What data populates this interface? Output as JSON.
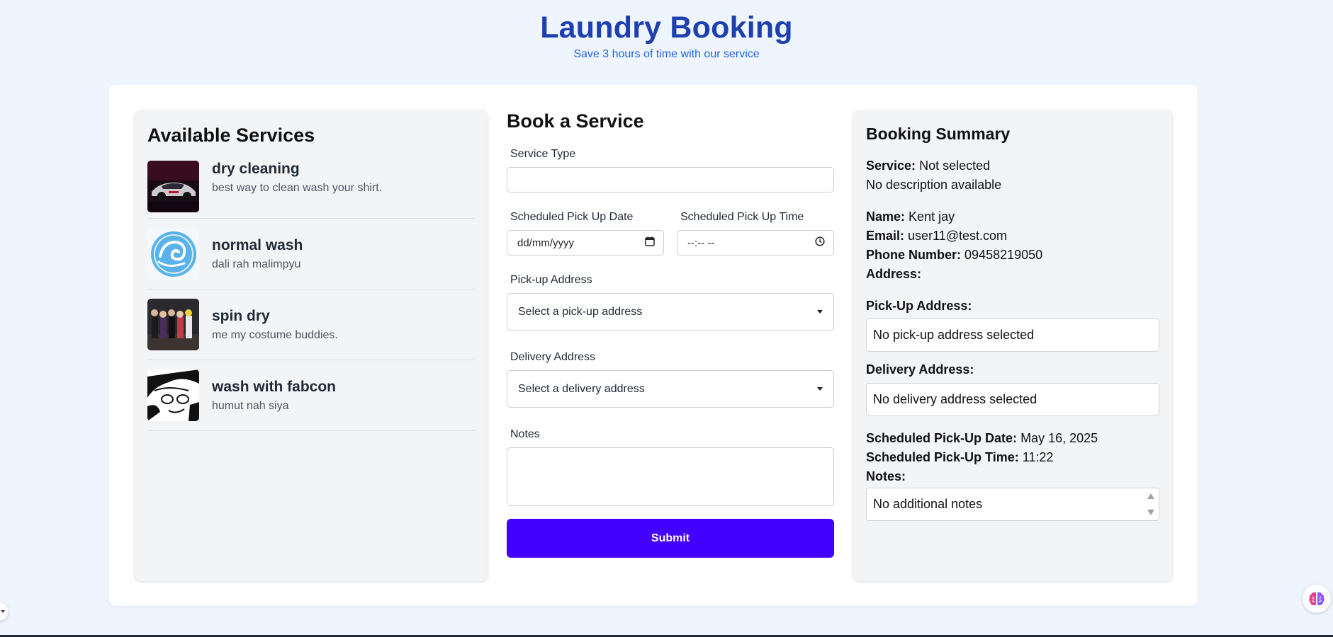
{
  "header": {
    "title": "Laundry Booking",
    "subtitle": "Save 3 hours of time with our service"
  },
  "services_panel": {
    "title": "Available Services",
    "items": [
      {
        "name": "dry cleaning",
        "description": "best way to clean wash your shirt.",
        "icon": "sports-car-photo"
      },
      {
        "name": "normal wash",
        "description": "dali rah malimpyu",
        "icon": "blue-swirl-logo"
      },
      {
        "name": "spin dry",
        "description": "me my costume buddies.",
        "icon": "group-costume-photo"
      },
      {
        "name": "wash with fabcon",
        "description": "humut nah siya",
        "icon": "manga-face-drawing"
      }
    ]
  },
  "form": {
    "title": "Book a Service",
    "service_type_label": "Service Type",
    "service_type_value": "",
    "pickup_date_label": "Scheduled Pick Up Date",
    "pickup_date_placeholder": "dd/mm/yyyy",
    "pickup_time_label": "Scheduled Pick Up Time",
    "pickup_time_placeholder": "--:-- --",
    "pickup_address_label": "Pick-up Address",
    "pickup_address_value": "Select a pick-up address",
    "delivery_address_label": "Delivery Address",
    "delivery_address_value": "Select a delivery address",
    "notes_label": "Notes",
    "notes_value": "",
    "submit_label": "Submit"
  },
  "summary": {
    "title": "Booking Summary",
    "service_label": "Service:",
    "service_value": "Not selected",
    "description": "No description available",
    "name_label": "Name:",
    "name_value": "Kent jay",
    "email_label": "Email:",
    "email_value": "user11@test.com",
    "phone_label": "Phone Number:",
    "phone_value": "09458219050",
    "address_label": "Address:",
    "pickup_address_label": "Pick-Up Address:",
    "pickup_address_value": "No pick-up address selected",
    "delivery_address_label": "Delivery Address:",
    "delivery_address_value": "No delivery address selected",
    "pickup_date_label": "Scheduled Pick-Up Date:",
    "pickup_date_value": "May 16, 2025",
    "pickup_time_label": "Scheduled Pick-Up Time:",
    "pickup_time_value": "11:22",
    "notes_label": "Notes:",
    "notes_value": "No additional notes"
  },
  "colors": {
    "title": "#1e40af",
    "subtitle": "#2563eb",
    "submit": "#4400ff",
    "page_bg": "#eef5ff"
  },
  "icons": [
    "calendar-icon",
    "clock-icon",
    "chevron-down-icon",
    "brain-icon",
    "expand-toggle-icon"
  ]
}
